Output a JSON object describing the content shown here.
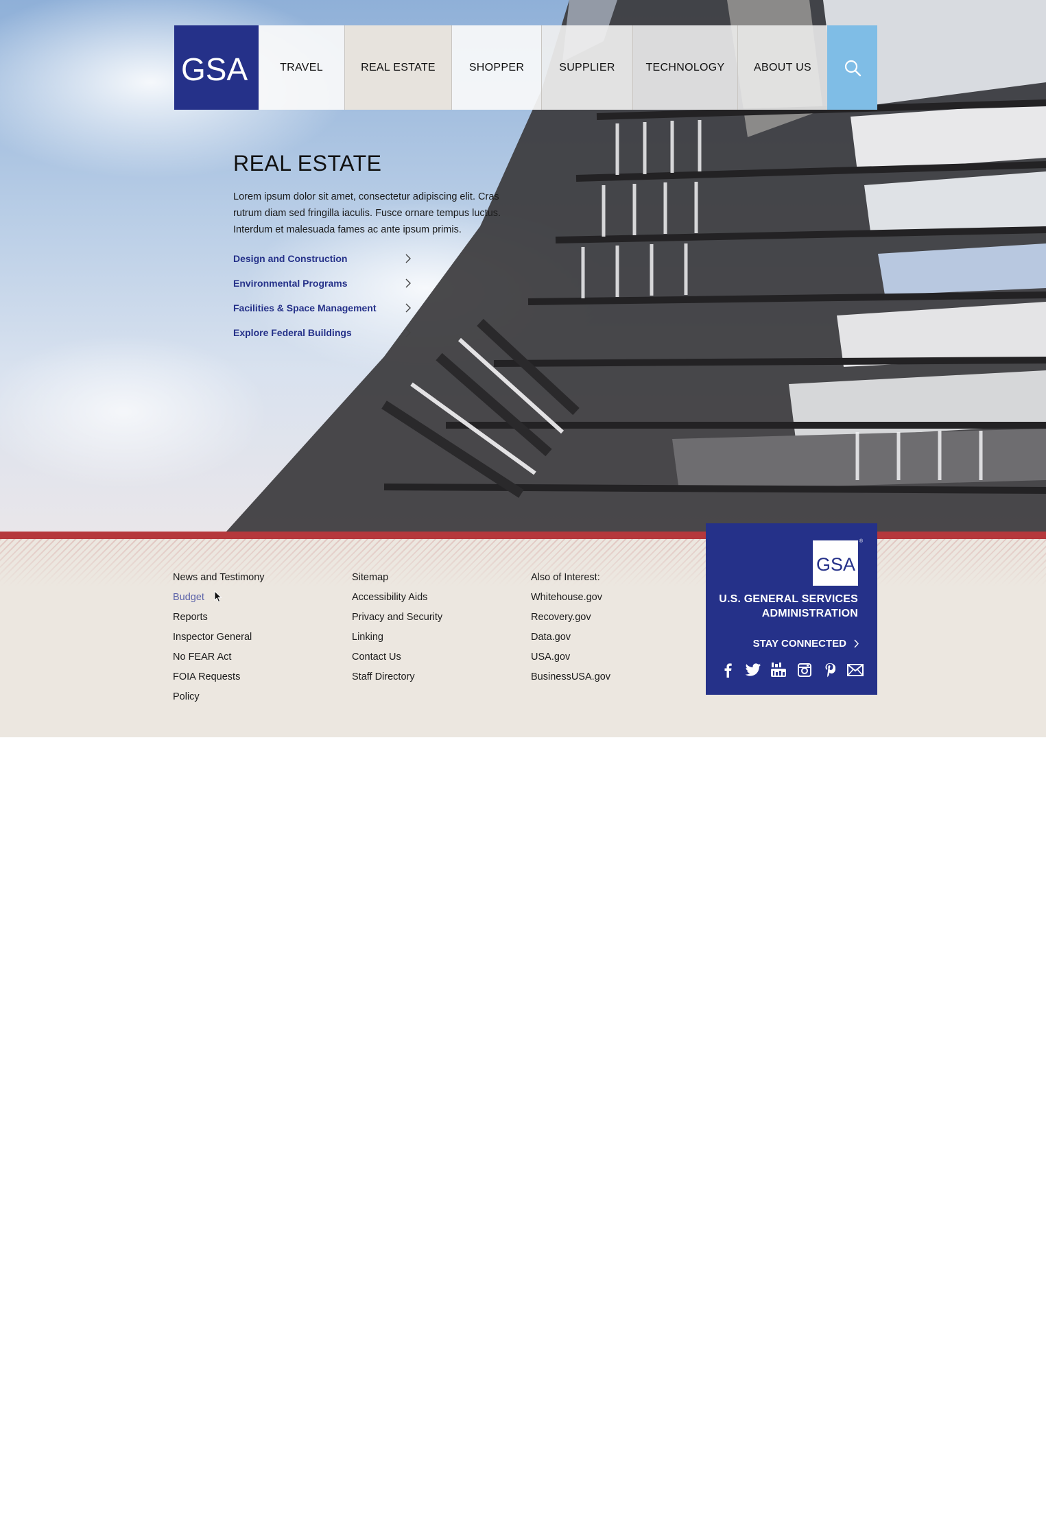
{
  "brand": {
    "logo_text": "GSA",
    "accent": "#253189",
    "red": "#b5383c",
    "search_color": "#7fbde6"
  },
  "nav": {
    "items": [
      {
        "label": "TRAVEL",
        "active": false
      },
      {
        "label": "REAL ESTATE",
        "active": true
      },
      {
        "label": "SHOPPER",
        "active": false
      },
      {
        "label": "SUPPLIER",
        "active": false
      },
      {
        "label": "TECHNOLOGY",
        "active": false
      },
      {
        "label": "ABOUT US",
        "active": false
      }
    ],
    "search_icon": "search-icon"
  },
  "hero": {
    "title": "REAL ESTATE",
    "body": "Lorem ipsum dolor sit amet, consectetur adipiscing elit. Cras rutrum diam sed fringilla iaculis. Fusce ornare tempus luctus. Interdum et malesuada fames ac ante ipsum primis.",
    "links": [
      "Design and Construction",
      "Environmental Programs",
      "Facilities & Space Management",
      "Explore Federal Buildings"
    ]
  },
  "footer": {
    "col1": [
      "News and Testimony",
      "Budget",
      "Reports",
      "Inspector General",
      "No FEAR Act",
      "FOIA Requests",
      "Policy"
    ],
    "col2": [
      "Sitemap",
      "Accessibility Aids",
      "Privacy and Security",
      "Linking",
      "Contact Us",
      "Staff Directory"
    ],
    "col3": [
      "Also of Interest:",
      "Whitehouse.gov",
      "Recovery.gov",
      "Data.gov",
      "USA.gov",
      "BusinessUSA.gov"
    ],
    "hovered_link": "Budget",
    "agency_line1": "U.S. GENERAL SERVICES",
    "agency_line2": "ADMINISTRATION",
    "stay_connected": "STAY CONNECTED",
    "registered_mark": "®",
    "socials": [
      "facebook-icon",
      "twitter-icon",
      "youtube-icon",
      "instagram-icon",
      "pinterest-icon",
      "email-icon"
    ]
  }
}
